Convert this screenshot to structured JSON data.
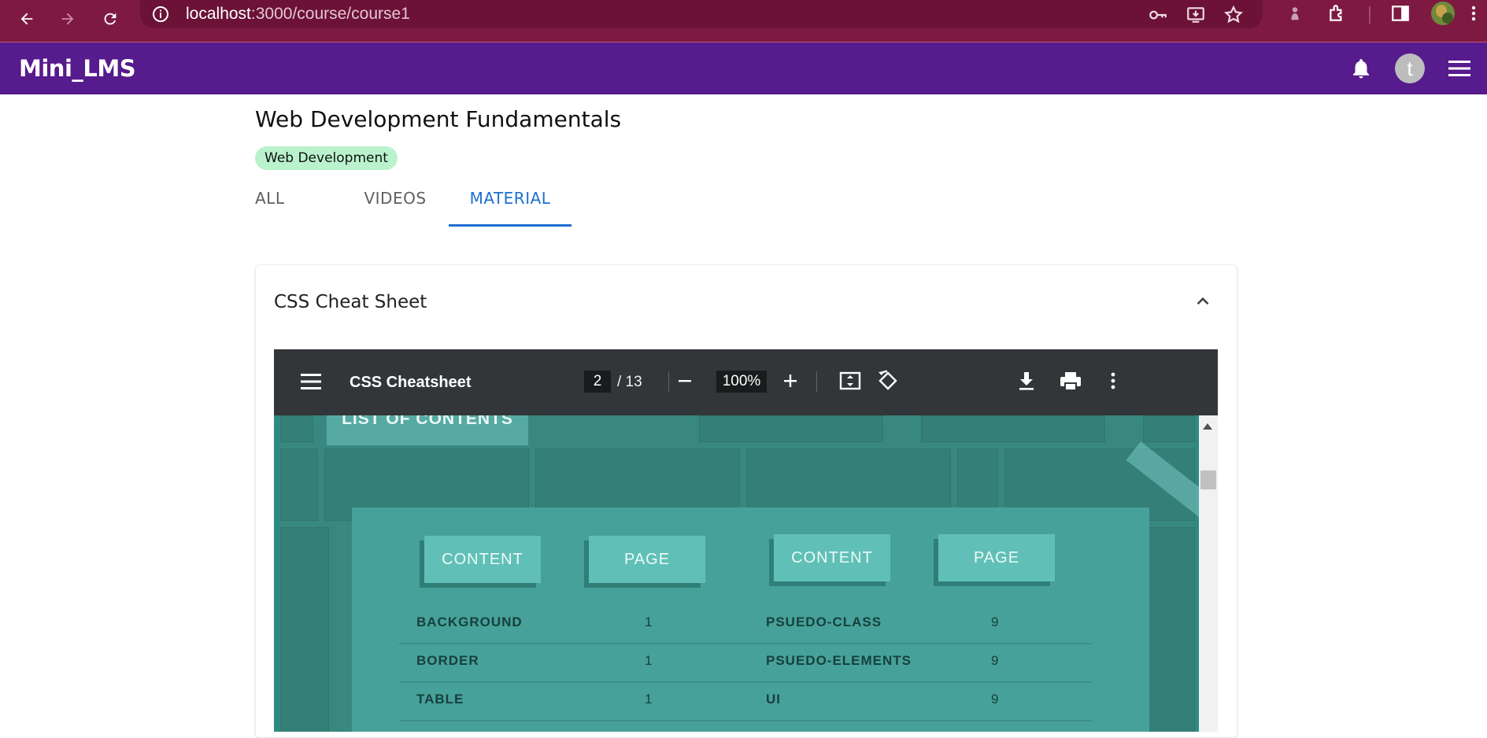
{
  "browser": {
    "url_host": "localhost",
    "url_path": ":3000/course/course1"
  },
  "app": {
    "title": "Mini_LMS",
    "avatar_initial": "t"
  },
  "course": {
    "title": "Web Development Fundamentals",
    "category": "Web Development",
    "tabs": [
      {
        "label": "ALL",
        "active": false
      },
      {
        "label": "VIDEOS",
        "active": false
      },
      {
        "label": "MATERIAL",
        "active": true
      }
    ]
  },
  "accordion": {
    "title": "CSS Cheat Sheet",
    "expanded": true
  },
  "pdf_viewer": {
    "document_title": "CSS Cheatsheet",
    "current_page": "2",
    "total_pages": "/ 13",
    "zoom": "100%"
  },
  "pdf_page": {
    "banner": "LIST OF CONTENTS",
    "header_content": "CONTENT",
    "header_page": "PAGE",
    "rows": [
      {
        "left_item": "BACKGROUND",
        "left_page": "1",
        "right_item": "PSUEDO-CLASS",
        "right_page": "9"
      },
      {
        "left_item": "BORDER",
        "left_page": "1",
        "right_item": "PSUEDO-ELEMENTS",
        "right_page": "9"
      },
      {
        "left_item": "TABLE",
        "left_page": "1",
        "right_item": "UI",
        "right_page": "9"
      }
    ]
  },
  "colors": {
    "browser_frame": "#7e1a42",
    "app_bar": "#561b8c",
    "tab_active": "#1e6fd0",
    "chip": "#b9f2cc",
    "pdf_toolbar": "#323639",
    "pdf_page_bg": "#388880"
  }
}
